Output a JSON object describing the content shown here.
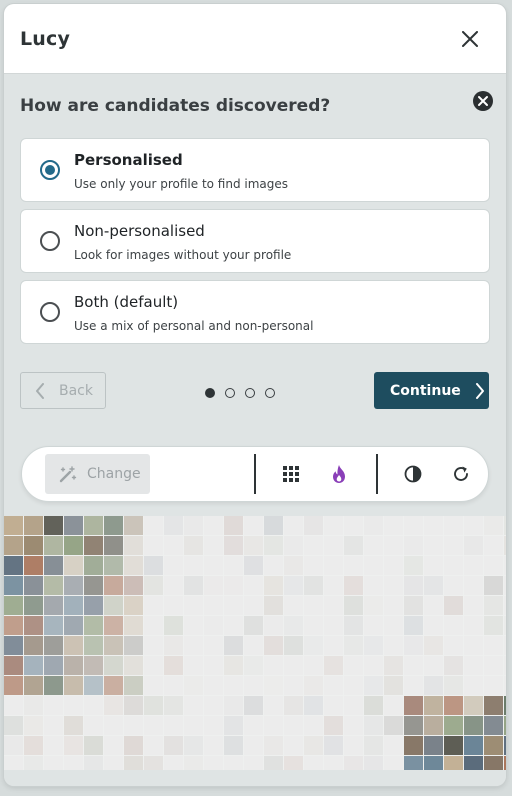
{
  "window": {
    "title": "Lucy"
  },
  "question": "How are candidates discovered?",
  "options": [
    {
      "title": "Personalised",
      "description": "Use only your profile to find images",
      "checked": true
    },
    {
      "title": "Non-personalised",
      "description": "Look for images without your profile",
      "checked": false
    },
    {
      "title": "Both (default)",
      "description": "Use a mix of personal and non-personal",
      "checked": false
    }
  ],
  "nav": {
    "back_label": "Back",
    "continue_label": "Continue",
    "steps": 4,
    "current_step": 1
  },
  "toolbar": {
    "change_label": "Change"
  },
  "colors": {
    "accent": "#1e4d5f",
    "radio": "#236a8a",
    "flame": "#8a3fb8"
  },
  "icons": [
    "close-icon",
    "dismiss-icon",
    "chevron-left-icon",
    "chevron-right-icon",
    "magic-wand-icon",
    "grid-icon",
    "flame-icon",
    "contrast-icon",
    "refresh-icon"
  ]
}
